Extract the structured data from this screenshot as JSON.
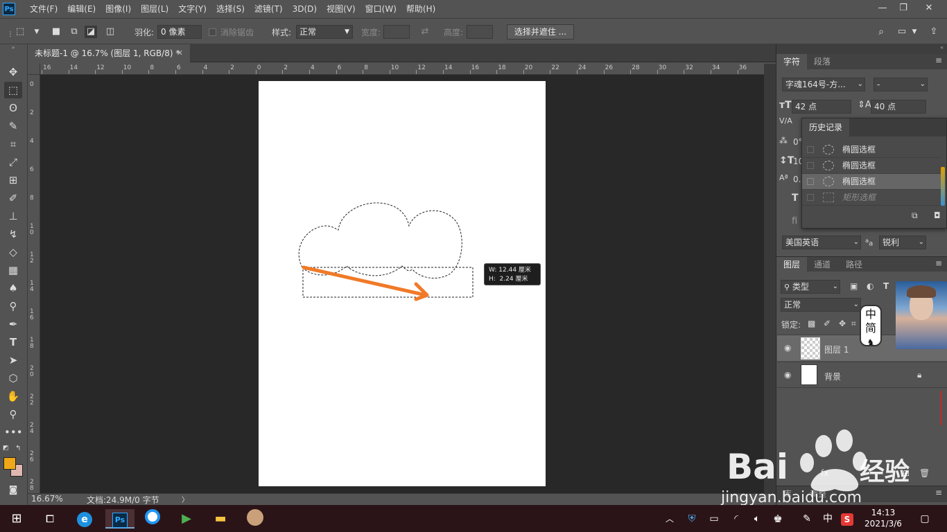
{
  "menubar": {
    "app_logo": "Ps",
    "items": [
      "文件(F)",
      "编辑(E)",
      "图像(I)",
      "图层(L)",
      "文字(Y)",
      "选择(S)",
      "滤镜(T)",
      "3D(D)",
      "视图(V)",
      "窗口(W)",
      "帮助(H)"
    ]
  },
  "options": {
    "feather_label": "羽化:",
    "feather_value": "0 像素",
    "antialias_label": "消除锯齿",
    "style_label": "样式:",
    "style_value": "正常",
    "width_label": "宽度:",
    "height_label": "高度:",
    "select_mask_button": "选择并遮住 ..."
  },
  "document": {
    "tab_title": "未标题-1 @ 16.7% (图层 1, RGB/8) *",
    "zoom": "16.67%",
    "doc_info": "文档:24.9M/0 字节"
  },
  "rulers": {
    "h_labels": [
      "16",
      "14",
      "12",
      "10",
      "8",
      "6",
      "4",
      "2",
      "0",
      "2",
      "4",
      "6",
      "8",
      "10",
      "12",
      "14",
      "16",
      "18",
      "20",
      "22",
      "24",
      "26",
      "28",
      "30",
      "32",
      "34",
      "36"
    ],
    "v_labels": [
      "0",
      "2",
      "4",
      "6",
      "8",
      "10",
      "12",
      "14",
      "16",
      "18",
      "20",
      "22",
      "24",
      "26",
      "28"
    ]
  },
  "transform_tooltip": {
    "w_label": "W:",
    "w_value": "12.44 厘米",
    "h_label": "H:",
    "h_value": "2.24 厘米"
  },
  "character_panel": {
    "tabs": [
      "字符",
      "段落"
    ],
    "font_family": "字魂164号-方...",
    "font_style": "-",
    "font_size": "42 点",
    "leading": "40 点",
    "language": "美国英语",
    "aa_label": "a",
    "antialias": "锐利",
    "partial_labels": [
      "0°",
      "10",
      "0."
    ]
  },
  "history_panel": {
    "title": "历史记录",
    "items": [
      {
        "label": "椭圆选框",
        "state": "normal"
      },
      {
        "label": "椭圆选框",
        "state": "normal"
      },
      {
        "label": "椭圆选框",
        "state": "selected"
      },
      {
        "label": "矩形选框",
        "state": "disabled"
      }
    ]
  },
  "layers_panel": {
    "tabs": [
      "图层",
      "通道",
      "路径"
    ],
    "filter_value": "类型",
    "blend_mode": "正常",
    "lock_label": "锁定:",
    "layers": [
      {
        "name": "图层 1",
        "visible": true,
        "locked": false
      },
      {
        "name": "背景",
        "visible": true,
        "locked": true
      }
    ],
    "bottom_tabs": [
      "库",
      "调整"
    ]
  },
  "ime_overlay": {
    "lang": "中",
    "mode": "简"
  },
  "taskbar": {
    "time": "14:13",
    "date": "2021/3/6",
    "ime": "中"
  },
  "watermark": {
    "brand": "Bai",
    "brand2": "经验",
    "url": "jingyan.baidu.com"
  },
  "colors": {
    "foreground": "#f0a818",
    "background": "#e0b8b0",
    "arrow": "#f07a28",
    "accent": "#31a8ff"
  }
}
